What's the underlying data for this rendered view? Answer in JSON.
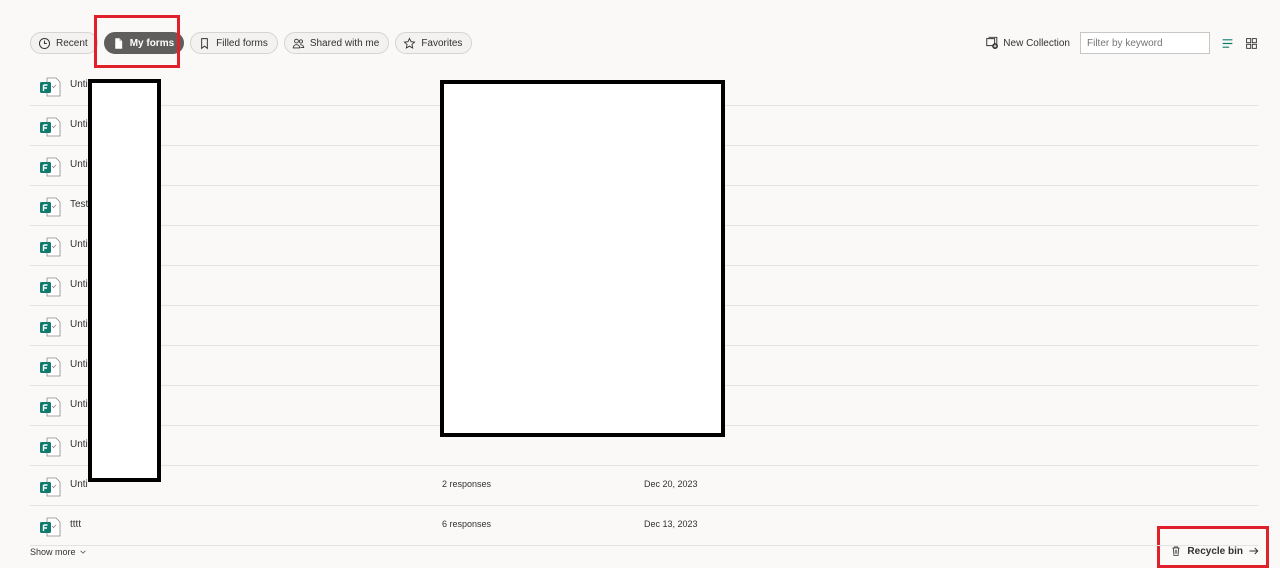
{
  "tabs": [
    {
      "label": "Recent",
      "icon": "clock-icon",
      "active": false
    },
    {
      "label": "My forms",
      "icon": "document-icon",
      "active": true
    },
    {
      "label": "Filled forms",
      "icon": "bookmark-icon",
      "active": false
    },
    {
      "label": "Shared with me",
      "icon": "people-icon",
      "active": false
    },
    {
      "label": "Favorites",
      "icon": "star-icon",
      "active": false
    }
  ],
  "toolbar": {
    "new_collection_label": "New Collection",
    "filter_placeholder": "Filter by keyword"
  },
  "forms": [
    {
      "name": "Unti",
      "responses": "",
      "date": ""
    },
    {
      "name": "Unti",
      "responses": "",
      "date": ""
    },
    {
      "name": "Unti",
      "responses": "",
      "date": ""
    },
    {
      "name": "Test",
      "responses": "",
      "date": ""
    },
    {
      "name": "Unti",
      "responses": "",
      "date": ""
    },
    {
      "name": "Unti",
      "responses": "",
      "date": ""
    },
    {
      "name": "Unti",
      "responses": "",
      "date": ""
    },
    {
      "name": "Unti",
      "responses": "",
      "date": ""
    },
    {
      "name": "Unti",
      "responses": "",
      "date": ""
    },
    {
      "name": "Unti",
      "responses": "",
      "date": ""
    },
    {
      "name": "Unti",
      "responses": "2 responses",
      "date": "Dec 20, 2023"
    },
    {
      "name": "tttt",
      "responses": "6 responses",
      "date": "Dec 13, 2023"
    }
  ],
  "footer": {
    "show_more_label": "Show more",
    "recycle_bin_label": "Recycle bin"
  },
  "colors": {
    "accent": "#0f7b6c",
    "active_tab": "#605e5c",
    "highlight": "#e0202a"
  }
}
